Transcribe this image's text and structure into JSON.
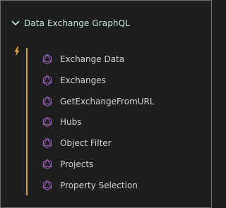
{
  "panel": {
    "title": "Data Exchange GraphQL",
    "expand_icon": "chevron-down-icon",
    "status_icon": "lightning-bolt-icon",
    "item_icon": "graphql-icon",
    "accent_color": "#c9a14c",
    "title_color": "#c6e6e7",
    "icon_color": "#8c5aa8",
    "items": [
      {
        "label": "Exchange Data"
      },
      {
        "label": "Exchanges"
      },
      {
        "label": "GetExchangeFromURL"
      },
      {
        "label": "Hubs"
      },
      {
        "label": "Object Filter"
      },
      {
        "label": "Projects"
      },
      {
        "label": "Property Selection"
      }
    ]
  }
}
